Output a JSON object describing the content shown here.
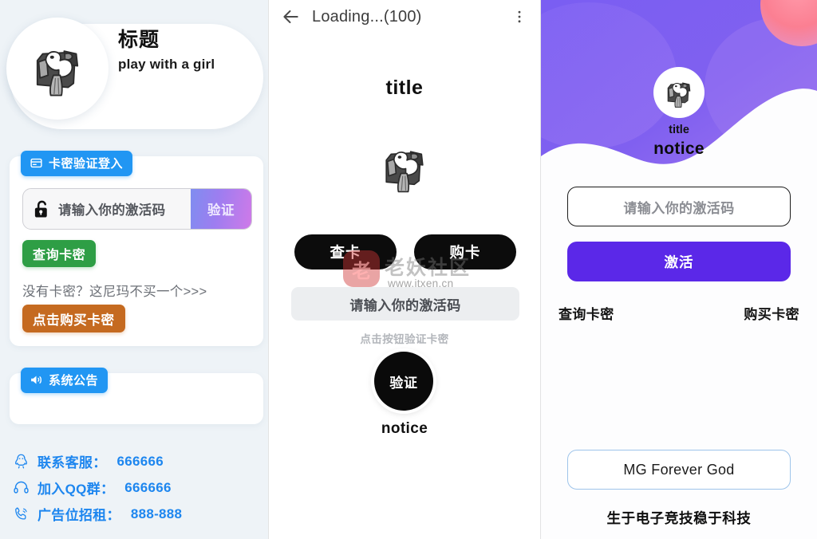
{
  "left_panel": {
    "hero": {
      "avatar_icon": "bear-illustration-avatar",
      "title": "标题",
      "subtitle": "play with a girl"
    },
    "login_card": {
      "badge_icon": "id-card-icon",
      "badge_label": "卡密验证登入",
      "input": {
        "lock_icon": "unlock-icon",
        "placeholder": "请输入你的激活码",
        "value": ""
      },
      "verify_button": "验证",
      "query_button": "查询卡密",
      "hint": "没有卡密？这尼玛不买一个>>>",
      "buy_button": "点击购买卡密"
    },
    "announcement": {
      "badge_icon": "speaker-icon",
      "badge_label": "系统公告",
      "body": ""
    },
    "contacts": [
      {
        "icon": "qq-penguin-icon",
        "label": "联系客服：",
        "value": "666666"
      },
      {
        "icon": "headset-icon",
        "label": "加入QQ群：",
        "value": "666666"
      },
      {
        "icon": "phone-icon",
        "label": "广告位招租：",
        "value": "888-888"
      }
    ]
  },
  "mid_panel": {
    "appbar": {
      "back_icon": "arrow-left-icon",
      "title": "Loading...(100)",
      "more_icon": "more-vertical-icon"
    },
    "title": "title",
    "avatar_icon": "bear-illustration-avatar",
    "check_button": "查卡",
    "purchase_button": "购卡",
    "input_placeholder": "请输入你的激活码",
    "sub_hint": "点击按钮验证卡密",
    "circle_button": "验证",
    "notice": "notice"
  },
  "watermark": {
    "logo_glyph": "老",
    "text": "老妖社区",
    "url": "www.itxen.cn"
  },
  "right_panel": {
    "hero": {
      "avatar_icon": "bear-illustration-avatar",
      "title": "title",
      "notice": "notice"
    },
    "input_placeholder": "请输入你的激活码",
    "activate_button": "激活",
    "link_query": "查询卡密",
    "link_buy": "购买卡密",
    "footer_box": "MG Forever God",
    "slogan": "生于电子竞技稳于科技"
  },
  "colors": {
    "left_bg": "#eef3f7",
    "badge_blue": "#2196f3",
    "link_blue": "#1d86ef",
    "green": "#2e9e45",
    "orange": "#c56a20",
    "purple": "#5b28e8",
    "hero_purple": "#7b5cf0",
    "pink": "#fb7f92",
    "dark": "#0c0c0c"
  }
}
